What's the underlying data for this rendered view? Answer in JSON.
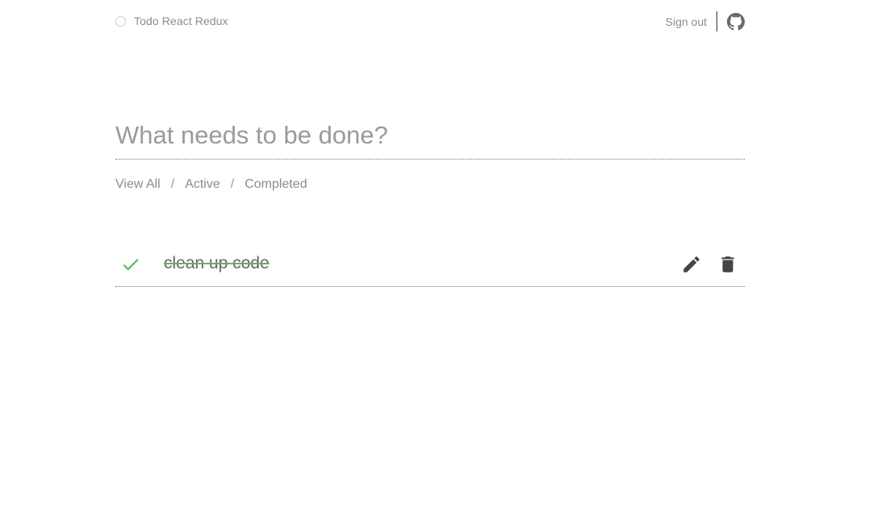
{
  "header": {
    "brand_label": "Todo React Redux",
    "sign_out_label": "Sign out",
    "github_icon": "github-icon",
    "brand_icon": "circle-icon"
  },
  "task_form": {
    "placeholder": "What needs to be done?",
    "value": ""
  },
  "filters": {
    "items": [
      "View All",
      "Active",
      "Completed"
    ],
    "separator": "/"
  },
  "tasks": [
    {
      "title": "clean up code",
      "completed": true,
      "check_icon": "check-icon",
      "edit_icon": "pencil-icon",
      "delete_icon": "trash-icon"
    }
  ],
  "colors": {
    "check": "#5cb85c",
    "text_muted": "#8c8c8c",
    "icon_dark": "#444444"
  }
}
